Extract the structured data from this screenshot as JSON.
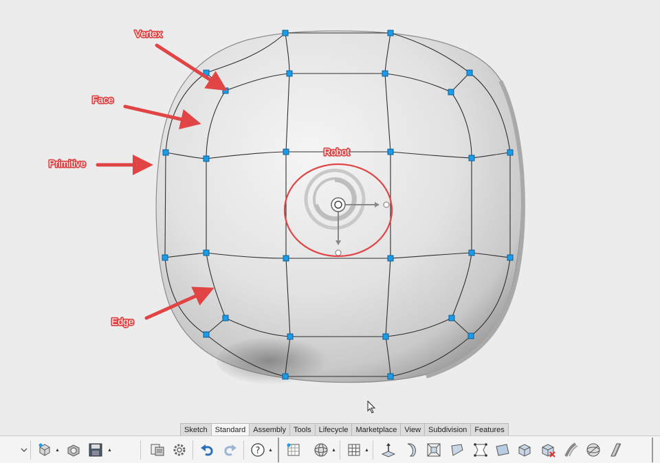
{
  "annotations": {
    "vertex": "Vertex",
    "face": "Face",
    "primitive": "Primitive",
    "edge": "Edge",
    "robot": "Robot"
  },
  "tabs": [
    {
      "label": "Sketch",
      "active": false
    },
    {
      "label": "Standard",
      "active": true
    },
    {
      "label": "Assembly",
      "active": false
    },
    {
      "label": "Tools",
      "active": false
    },
    {
      "label": "Lifecycle",
      "active": false
    },
    {
      "label": "Marketplace",
      "active": false
    },
    {
      "label": "View",
      "active": false
    },
    {
      "label": "Subdivision",
      "active": false
    },
    {
      "label": "Features",
      "active": false
    }
  ],
  "toolbar_icons": [
    "collapse-chevron-icon",
    "new-part-icon",
    "open-part-icon",
    "save-icon",
    "properties-icon",
    "settings-gear-icon",
    "undo-icon",
    "redo-icon",
    "help-icon",
    "grid-frame-icon",
    "display-mode-sphere-icon",
    "grid-icon",
    "vertex-pull-icon",
    "edge-tool-icon",
    "face-extrude-icon",
    "bridge-icon",
    "fill-hole-icon",
    "plane-icon",
    "box-icon",
    "delete-face-icon",
    "crease-icon",
    "sphere-icon",
    "uncrease-icon"
  ],
  "colors": {
    "accent_annotation": "#e04444",
    "control_point": "#1e9be6",
    "background": "#ececec"
  }
}
